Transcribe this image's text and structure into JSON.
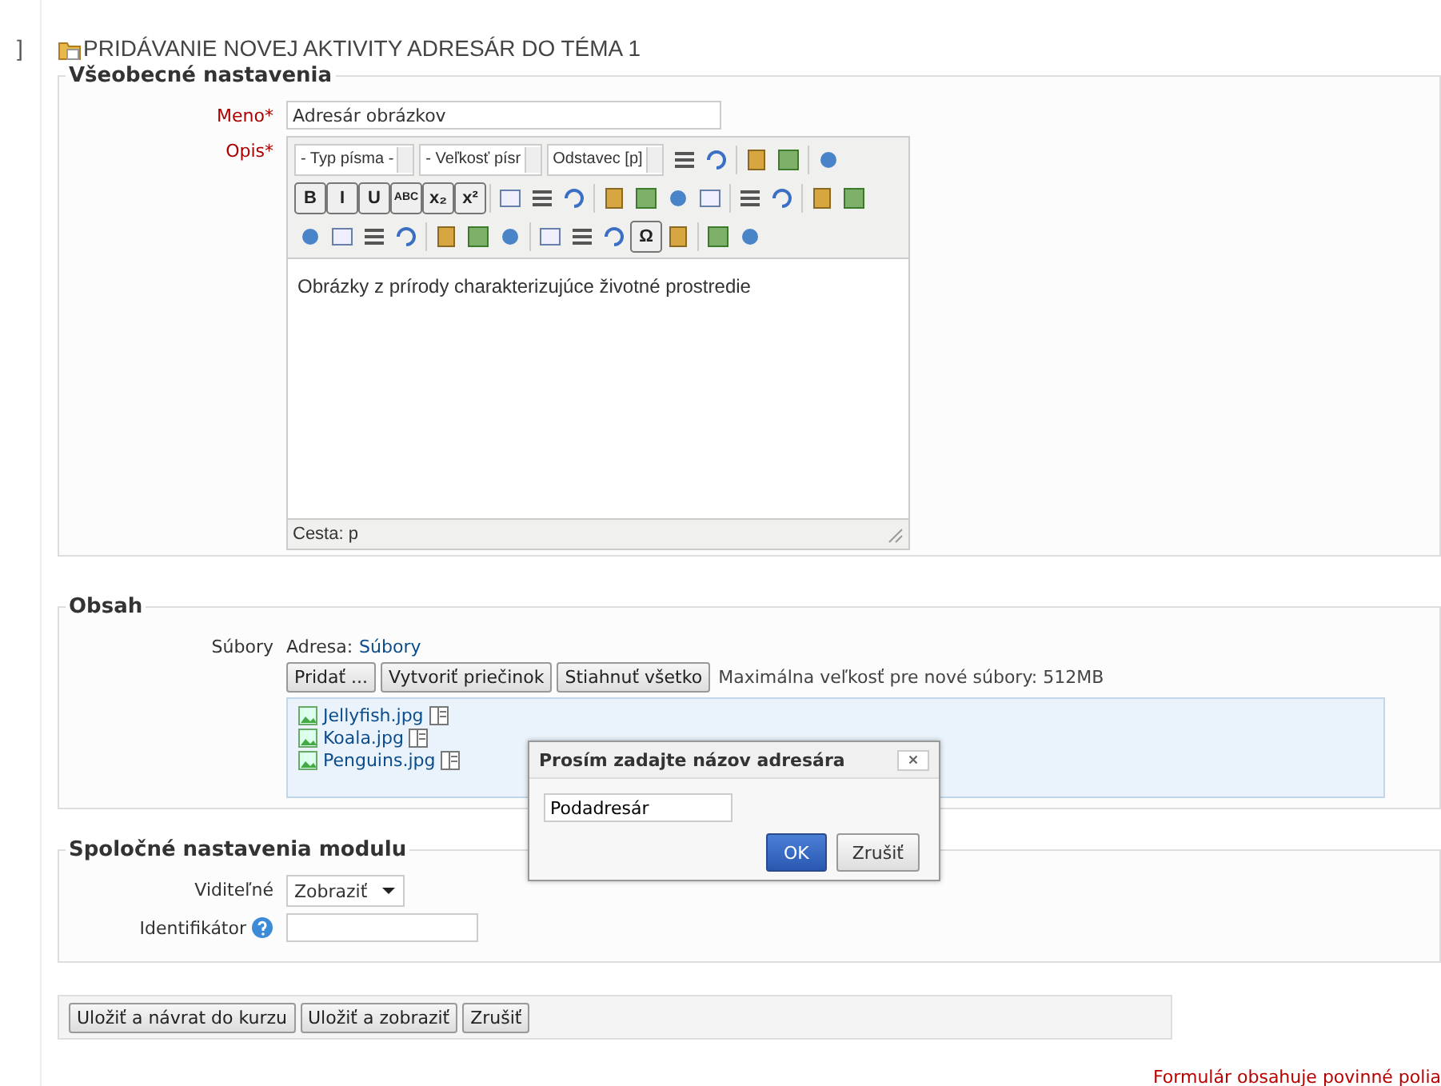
{
  "gutter_mark": "]",
  "page_title": "PRIDÁVANIE NOVEJ AKTIVITY ADRESÁR DO TÉMA 1",
  "general": {
    "legend": "Všeobecné nastavenia",
    "name": {
      "label": "Meno",
      "required_mark": "*",
      "value": "Adresár obrázkov"
    },
    "description": {
      "label": "Opis",
      "required_mark": "*",
      "toolbar_rows": [
        [
          {
            "kind": "select",
            "label": "- Typ písma -"
          },
          {
            "kind": "select",
            "label": "- Veľkosť písr"
          },
          {
            "kind": "select",
            "label": "Odstavec [p]"
          },
          {
            "kind": "icon"
          },
          {
            "kind": "icon"
          },
          {
            "kind": "sep"
          },
          {
            "kind": "icon"
          },
          {
            "kind": "icon"
          },
          {
            "kind": "sep"
          },
          {
            "kind": "icon"
          }
        ],
        [
          {
            "kind": "glyph",
            "label": "B"
          },
          {
            "kind": "glyph",
            "label": "I"
          },
          {
            "kind": "glyph",
            "label": "U"
          },
          {
            "kind": "glyph",
            "label": "ABC"
          },
          {
            "kind": "glyph",
            "label": "x₂"
          },
          {
            "kind": "glyph",
            "label": "x²"
          },
          {
            "kind": "sep"
          },
          {
            "kind": "icon"
          },
          {
            "kind": "icon"
          },
          {
            "kind": "icon"
          },
          {
            "kind": "sep"
          },
          {
            "kind": "icon"
          },
          {
            "kind": "icon"
          },
          {
            "kind": "icon"
          },
          {
            "kind": "icon"
          },
          {
            "kind": "sep"
          },
          {
            "kind": "icon"
          },
          {
            "kind": "icon"
          },
          {
            "kind": "sep"
          },
          {
            "kind": "icon"
          },
          {
            "kind": "icon"
          }
        ],
        [
          {
            "kind": "icon"
          },
          {
            "kind": "icon"
          },
          {
            "kind": "icon"
          },
          {
            "kind": "icon"
          },
          {
            "kind": "sep"
          },
          {
            "kind": "icon"
          },
          {
            "kind": "icon"
          },
          {
            "kind": "icon"
          },
          {
            "kind": "sep"
          },
          {
            "kind": "icon"
          },
          {
            "kind": "icon"
          },
          {
            "kind": "icon"
          },
          {
            "kind": "glyph",
            "label": "Ω"
          },
          {
            "kind": "icon"
          },
          {
            "kind": "sep"
          },
          {
            "kind": "icon"
          },
          {
            "kind": "icon"
          }
        ]
      ],
      "content": "Obrázky z prírody charakterizujúce životné prostredie",
      "path": "Cesta: p"
    }
  },
  "content": {
    "legend": "Obsah",
    "files_label": "Súbory",
    "path_label": "Adresa:",
    "path_link": "Súbory",
    "buttons": [
      "Pridať ...",
      "Vytvoriť priečinok",
      "Stiahnuť všetko"
    ],
    "max_size": "Maximálna veľkosť pre nové súbory: 512MB",
    "files": [
      {
        "name": "Jellyfish.jpg"
      },
      {
        "name": "Koala.jpg"
      },
      {
        "name": "Penguins.jpg"
      }
    ]
  },
  "dialog": {
    "title": "Prosím zadajte názov adresára",
    "value": "Podadresár",
    "buttons": [
      {
        "label": "OK",
        "primary": true
      },
      {
        "label": "Zrušiť",
        "primary": false
      }
    ]
  },
  "common": {
    "legend": "Spoločné nastavenia modulu",
    "visible": {
      "label": "Viditeľné",
      "value": "Zobraziť"
    },
    "idnumber": {
      "label": "Identifikátor"
    }
  },
  "actions": [
    "Uložiť a návrat do kurzu",
    "Uložiť a zobraziť",
    "Zrušiť"
  ],
  "required_note": "Formulár obsahuje povinné polia"
}
